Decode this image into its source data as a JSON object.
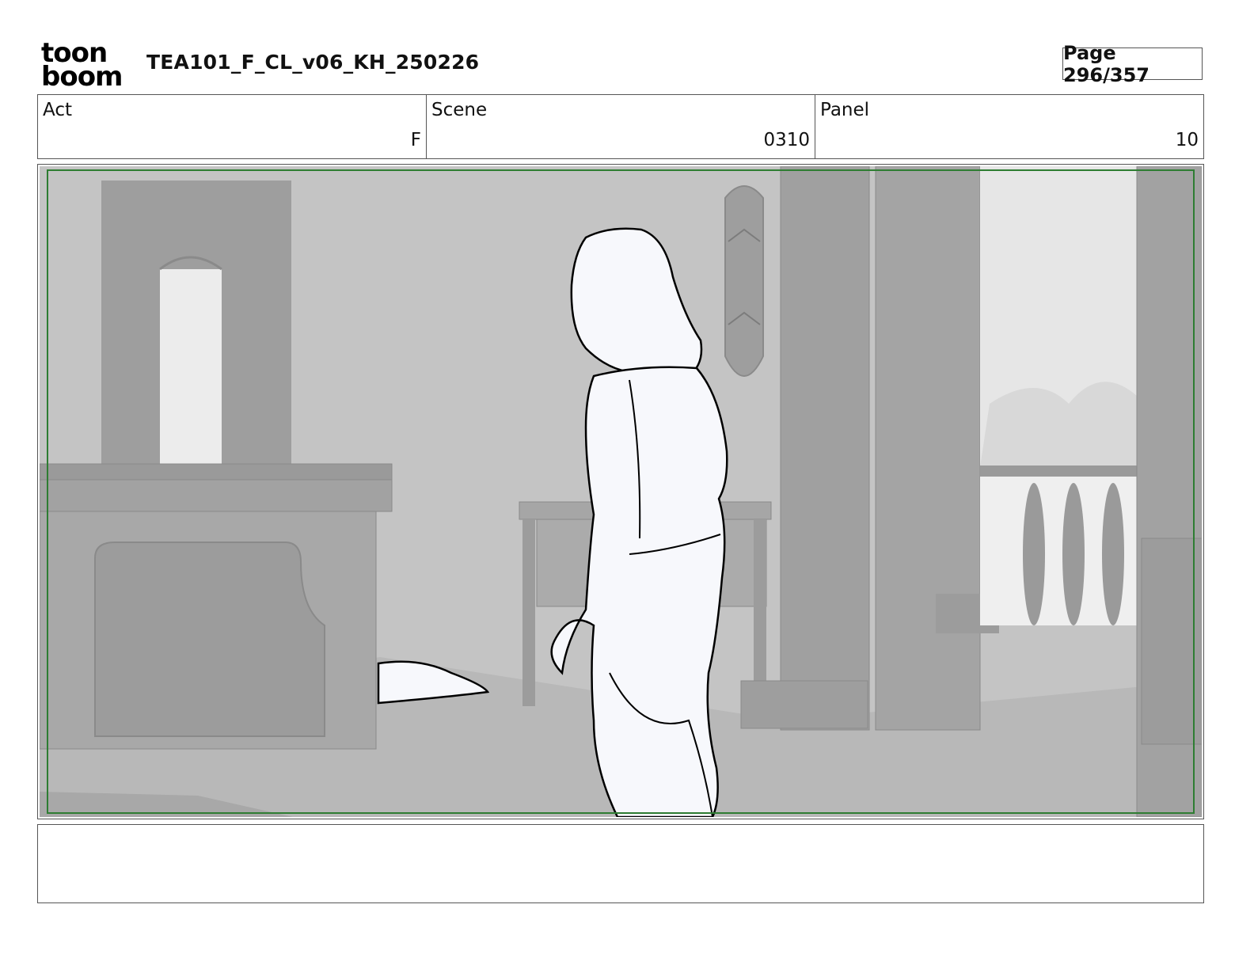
{
  "header": {
    "logo": {
      "line1": "toon",
      "line2": "boom",
      "alt": "toonboom-logo"
    },
    "title": "TEA101_F_CL_v06_KH_250226",
    "page": "Page 296/357"
  },
  "info": {
    "act_label": "Act",
    "act_value": "F",
    "scene_label": "Scene",
    "scene_value": "0310",
    "panel_label": "Panel",
    "panel_value": "10"
  },
  "panel": {
    "description_icon": "storyboard-panel-drawing",
    "safe_frame_color": "#2e7d32"
  },
  "notes": {
    "text": ""
  }
}
